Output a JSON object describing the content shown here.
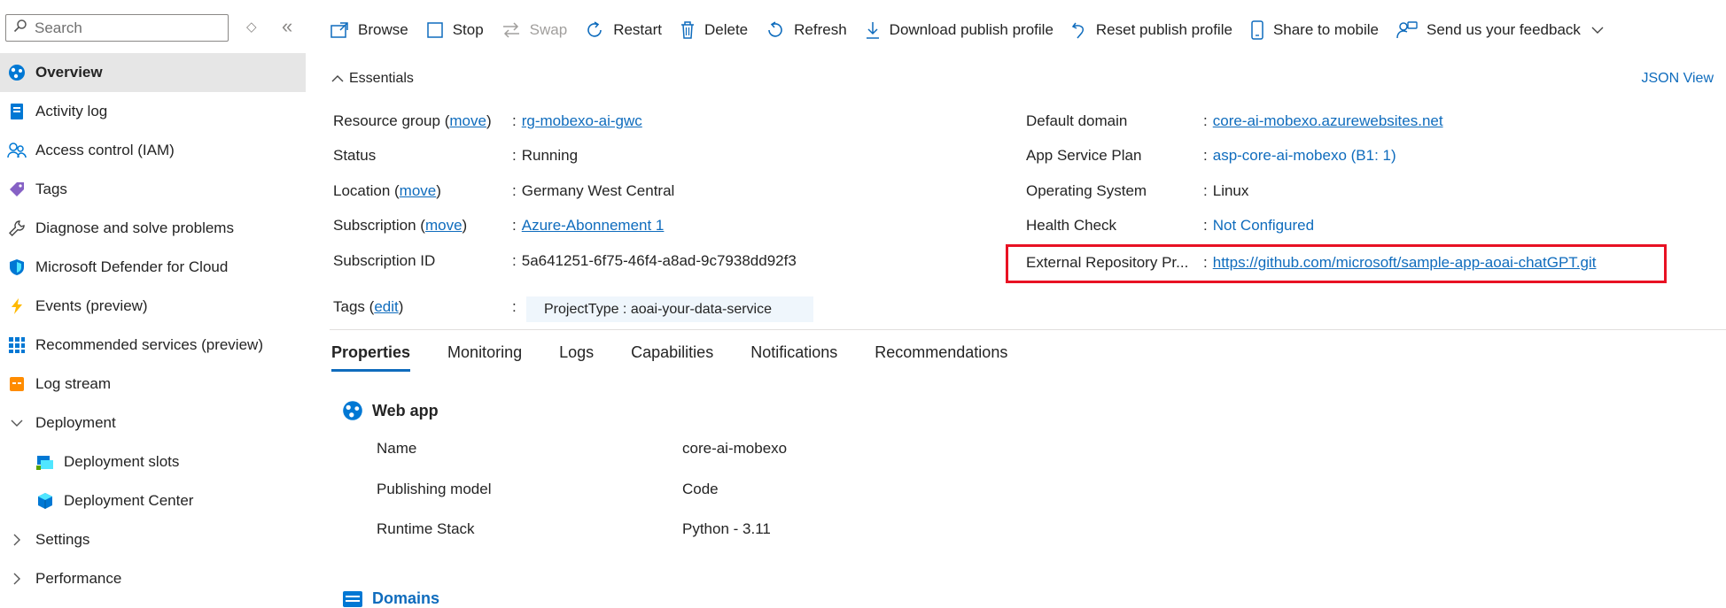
{
  "sidebar": {
    "search_placeholder": "Search",
    "items": [
      {
        "label": "Overview",
        "icon": "globe-icon"
      },
      {
        "label": "Activity log",
        "icon": "activity-log-icon"
      },
      {
        "label": "Access control (IAM)",
        "icon": "people-icon"
      },
      {
        "label": "Tags",
        "icon": "tag-icon"
      },
      {
        "label": "Diagnose and solve problems",
        "icon": "wrench-icon"
      },
      {
        "label": "Microsoft Defender for Cloud",
        "icon": "shield-icon"
      },
      {
        "label": "Events (preview)",
        "icon": "lightning-icon"
      },
      {
        "label": "Recommended services (preview)",
        "icon": "grid-icon"
      },
      {
        "label": "Log stream",
        "icon": "log-stream-icon"
      },
      {
        "label": "Deployment",
        "icon": "chevron-down-icon"
      },
      {
        "label": "Deployment slots",
        "icon": "deployment-slots-icon"
      },
      {
        "label": "Deployment Center",
        "icon": "cube-icon"
      },
      {
        "label": "Settings",
        "icon": "chevron-right-icon"
      },
      {
        "label": "Performance",
        "icon": "chevron-right-icon"
      }
    ]
  },
  "toolbar": {
    "browse": "Browse",
    "stop": "Stop",
    "swap": "Swap",
    "restart": "Restart",
    "delete": "Delete",
    "refresh": "Refresh",
    "download_publish_profile": "Download publish profile",
    "reset_publish_profile": "Reset publish profile",
    "share_to_mobile": "Share to mobile",
    "send_feedback": "Send us your feedback"
  },
  "essentials": {
    "title": "Essentials",
    "json_view": "JSON View",
    "move": "move",
    "edit": "edit",
    "left": {
      "resource_group_label": "Resource group",
      "resource_group_value": "rg-mobexo-ai-gwc",
      "status_label": "Status",
      "status_value": "Running",
      "location_label": "Location",
      "location_value": "Germany West Central",
      "subscription_label": "Subscription",
      "subscription_value": "Azure-Abonnement 1",
      "subscription_id_label": "Subscription ID",
      "subscription_id_value": "5a641251-6f75-46f4-a8ad-9c7938dd92f3",
      "tags_label": "Tags",
      "tag_value": "ProjectType : aoai-your-data-service"
    },
    "right": {
      "default_domain_label": "Default domain",
      "default_domain_value": "core-ai-mobexo.azurewebsites.net",
      "app_service_plan_label": "App Service Plan",
      "app_service_plan_value": "asp-core-ai-mobexo (B1: 1)",
      "os_label": "Operating System",
      "os_value": "Linux",
      "health_check_label": "Health Check",
      "health_check_value": "Not Configured",
      "external_repo_label": "External Repository Pr...",
      "external_repo_value": "https://github.com/microsoft/sample-app-aoai-chatGPT.git"
    }
  },
  "tabs": [
    "Properties",
    "Monitoring",
    "Logs",
    "Capabilities",
    "Notifications",
    "Recommendations"
  ],
  "properties": {
    "web_app_title": "Web app",
    "rows": [
      {
        "label": "Name",
        "value": "core-ai-mobexo"
      },
      {
        "label": "Publishing model",
        "value": "Code"
      },
      {
        "label": "Runtime Stack",
        "value": "Python - 3.11"
      }
    ],
    "domains_title": "Domains"
  },
  "colors": {
    "accent": "#0f6cbd",
    "highlight": "#e81123",
    "selected_bg": "#e6e6e6"
  }
}
